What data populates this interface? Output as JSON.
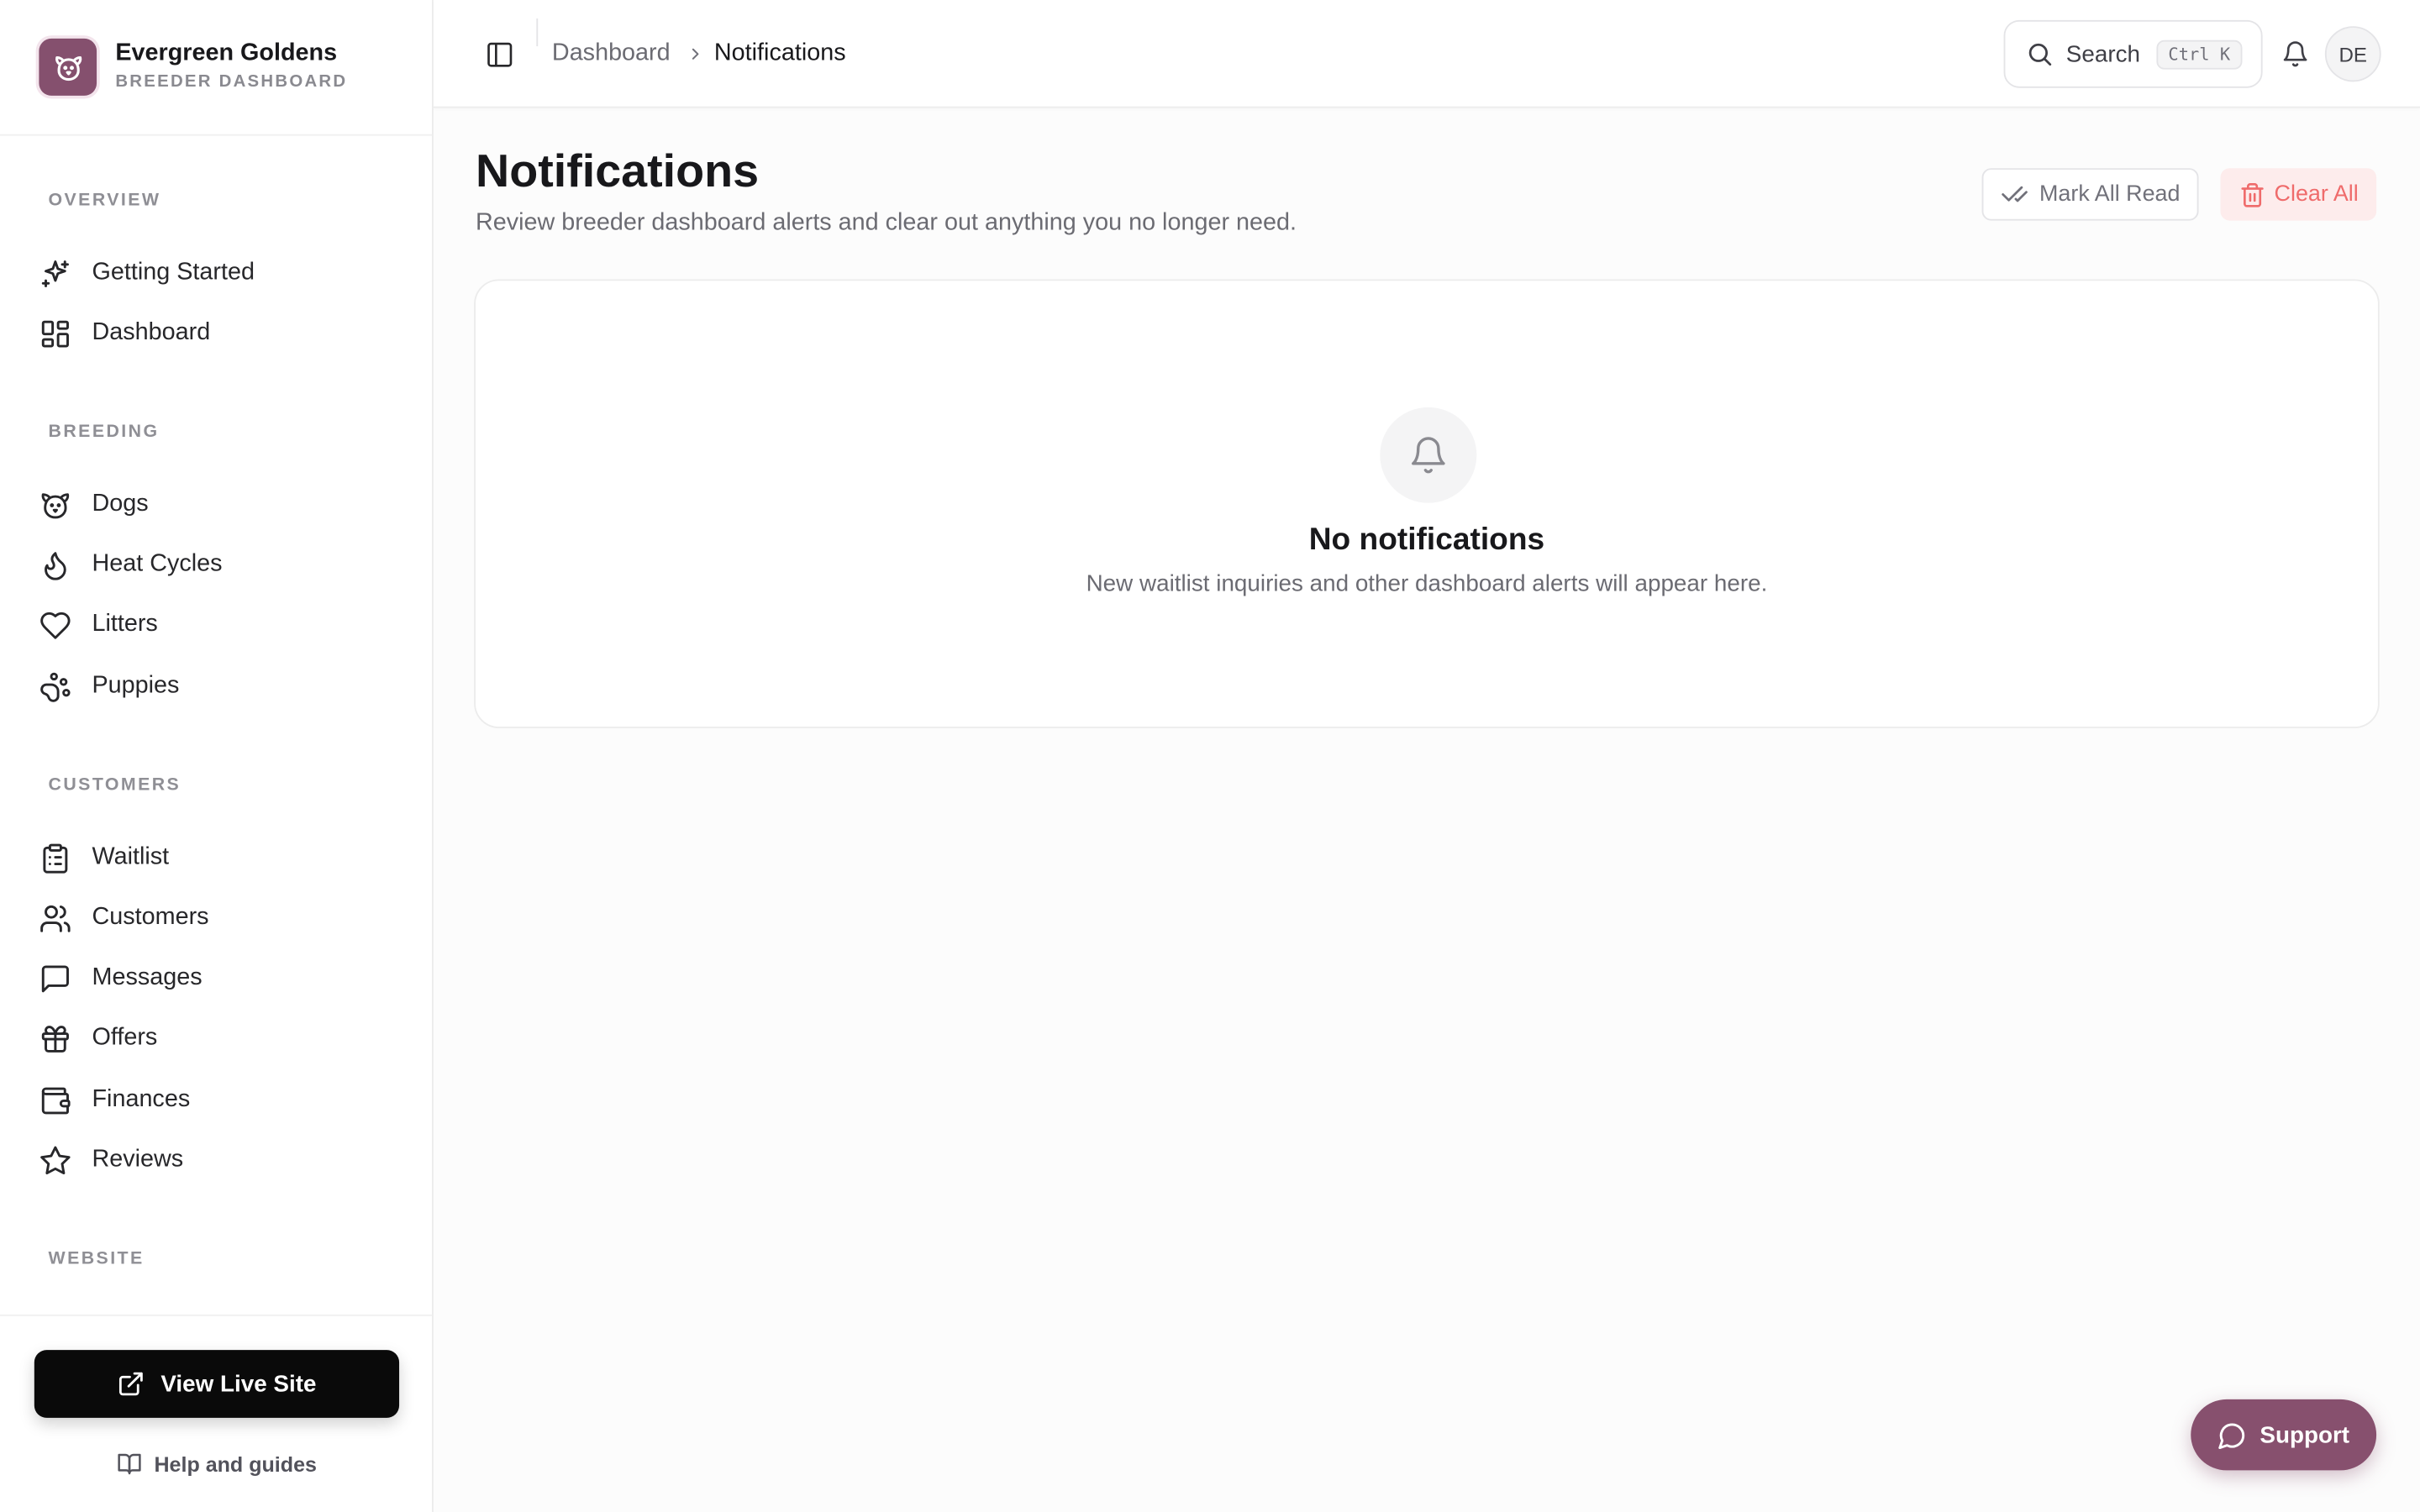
{
  "brand": {
    "name": "Evergreen Goldens",
    "subtitle": "BREEDER DASHBOARD",
    "logo_icon": "dog-face-icon",
    "accent": "#85506e"
  },
  "sidebar": {
    "sections": {
      "overview": "OVERVIEW",
      "breeding": "BREEDING",
      "customers": "CUSTOMERS",
      "website": "WEBSITE"
    },
    "items": [
      {
        "label": "Getting Started",
        "icon": "sparkles-icon"
      },
      {
        "label": "Dashboard",
        "icon": "layout-grid-icon"
      },
      {
        "label": "Dogs",
        "icon": "dog-icon"
      },
      {
        "label": "Heat Cycles",
        "icon": "flame-icon"
      },
      {
        "label": "Litters",
        "icon": "heart-icon"
      },
      {
        "label": "Puppies",
        "icon": "paw-icon"
      },
      {
        "label": "Waitlist",
        "icon": "clipboard-list-icon"
      },
      {
        "label": "Customers",
        "icon": "users-icon"
      },
      {
        "label": "Messages",
        "icon": "message-square-icon"
      },
      {
        "label": "Offers",
        "icon": "gift-icon"
      },
      {
        "label": "Finances",
        "icon": "wallet-icon"
      },
      {
        "label": "Reviews",
        "icon": "star-icon"
      }
    ],
    "live_site_label": "View Live Site",
    "help_label": "Help and guides"
  },
  "header": {
    "breadcrumb": [
      "Dashboard",
      "Notifications"
    ],
    "search_label": "Search",
    "search_shortcut": "Ctrl K",
    "avatar_initials": "DE"
  },
  "main": {
    "title": "Notifications",
    "subtitle": "Review breeder dashboard alerts and clear out anything you no longer need.",
    "mark_all_read_label": "Mark All Read",
    "clear_all_label": "Clear All",
    "empty_title": "No notifications",
    "empty_subtitle": "New waitlist inquiries and other dashboard alerts will appear here."
  },
  "support_label": "Support",
  "colors": {
    "danger": "#ef6b6b",
    "danger_bg": "#fdecec",
    "support": "#87506e"
  }
}
